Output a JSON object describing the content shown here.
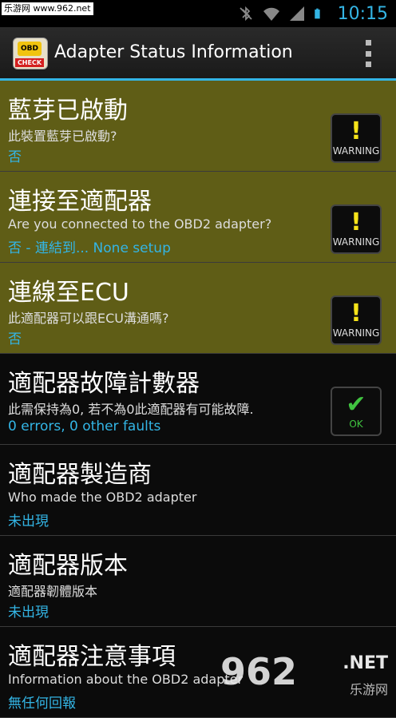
{
  "status_bar": {
    "watermark": "乐游网 www.962.net",
    "time": "10:15"
  },
  "action_bar": {
    "title": "Adapter Status Information",
    "icon_text_top": "OBD",
    "icon_text_bottom": "CHECK"
  },
  "items": [
    {
      "title": "藍芽已啟動",
      "desc": "此裝置藍芽已啟動?",
      "value": "否",
      "badge": "WARNING"
    },
    {
      "title": "連接至適配器",
      "desc": "Are you connected to the OBD2 adapter?",
      "value": "否 - 連結到... None setup",
      "badge": "WARNING"
    },
    {
      "title": "連線至ECU",
      "desc": "此適配器可以跟ECU溝通嗎?",
      "value": "否",
      "badge": "WARNING"
    },
    {
      "title": "適配器故障計數器",
      "desc": "此需保持為0, 若不為0此適配器有可能故障.",
      "value": "0 errors, 0 other faults",
      "badge": "OK"
    },
    {
      "title": "適配器製造商",
      "desc": "Who made the OBD2 adapter",
      "value": "未出現"
    },
    {
      "title": "適配器版本",
      "desc": "適配器韌體版本",
      "value": "未出現"
    },
    {
      "title": "適配器注意事項",
      "desc": "Information about the OBD2 adapter",
      "value": "無任何回報"
    }
  ],
  "watermark_bottom": {
    "big": "962",
    "net": ".NET",
    "cn": "乐游网"
  },
  "colors": {
    "accent": "#33b5e5",
    "warning_row": "#5f5d16"
  }
}
